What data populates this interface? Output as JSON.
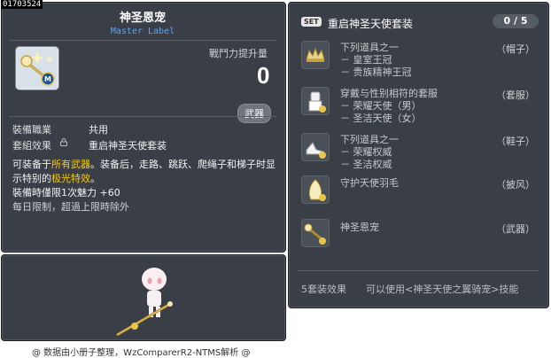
{
  "item_id": "01703524",
  "item": {
    "name": "神圣恩宠",
    "label": "Master Label",
    "power_label": "戰鬥力提升量",
    "power_value": "0",
    "category_badge": "武器",
    "job_label": "裝備職業",
    "job_value": "共用",
    "set_label": "套組效果",
    "set_value": "重启神圣天使套装",
    "desc_pre": "可装备于",
    "desc_hl1": "所有武器",
    "desc_mid": "。装备后，走路、跳跃、爬绳子和梯子时显示特别的",
    "desc_hl2": "极光特效",
    "desc_end": "。",
    "charm_line": "裝備時僅限1次魅力  +60",
    "limit_line": "每日限制，超過上限時除外"
  },
  "set": {
    "badge": "SET",
    "title": "重启神圣天使套装",
    "count": "0 / 5",
    "items": [
      {
        "icon": "crown-icon",
        "lines": [
          "下列道具之一",
          "－ 皇室王冠",
          "－ 贵族精神王冠"
        ],
        "tag": "（帽子）"
      },
      {
        "icon": "suit-icon",
        "lines": [
          "穿戴与性别相符的套服",
          "－ 荣耀天使（男）",
          "－ 圣洁天使（女）"
        ],
        "tag": "（套服）"
      },
      {
        "icon": "shoes-icon",
        "lines": [
          "下列道具之一",
          "－ 荣耀权威",
          "－ 圣洁权威"
        ],
        "tag": "（鞋子）"
      },
      {
        "icon": "feather-cape-icon",
        "lines": [
          "守护天使羽毛"
        ],
        "tag": "（披风）"
      },
      {
        "icon": "staff-icon",
        "lines": [
          "神圣恩宠"
        ],
        "tag": "（武器）"
      }
    ],
    "effect_label": "5套装效果",
    "effect_text": "可以使用<神圣天使之翼骑宠>技能"
  },
  "footer": "@ 数据由小册子整理，WzComparerR2-NTMS解析 @",
  "colors": {
    "panel_bg": "#3a3f47",
    "title_blue": "#4fa8ff",
    "highlight": "#ffcc00"
  }
}
